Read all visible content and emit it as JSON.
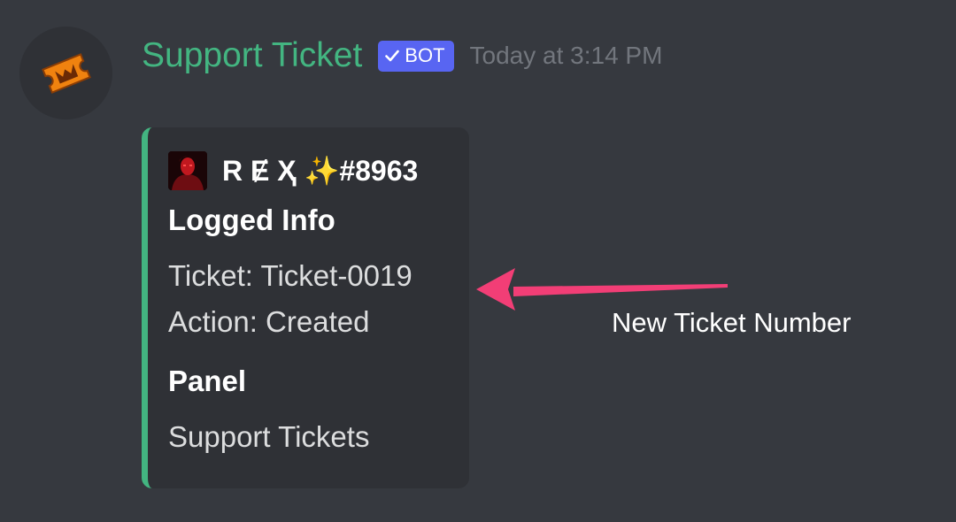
{
  "message": {
    "avatar_icon": "ticket-icon",
    "username": "Support Ticket",
    "bot_badge": "BOT",
    "timestamp": "Today at 3:14 PM"
  },
  "embed": {
    "accent_color": "#43b581",
    "author": {
      "name": "R Ɇ Ҳ ✨#8963"
    },
    "fields": [
      {
        "name": "Logged Info",
        "lines": [
          "Ticket: Ticket-0019",
          "Action: Created"
        ]
      },
      {
        "name": "Panel",
        "lines": [
          "Support Tickets"
        ]
      }
    ]
  },
  "annotation": {
    "text": "New Ticket Number",
    "arrow_color": "#f23e76"
  },
  "colors": {
    "background": "#36393f",
    "embed_background": "#2f3136",
    "username": "#43b581",
    "badge": "#5865f2",
    "timestamp": "#72767d"
  }
}
